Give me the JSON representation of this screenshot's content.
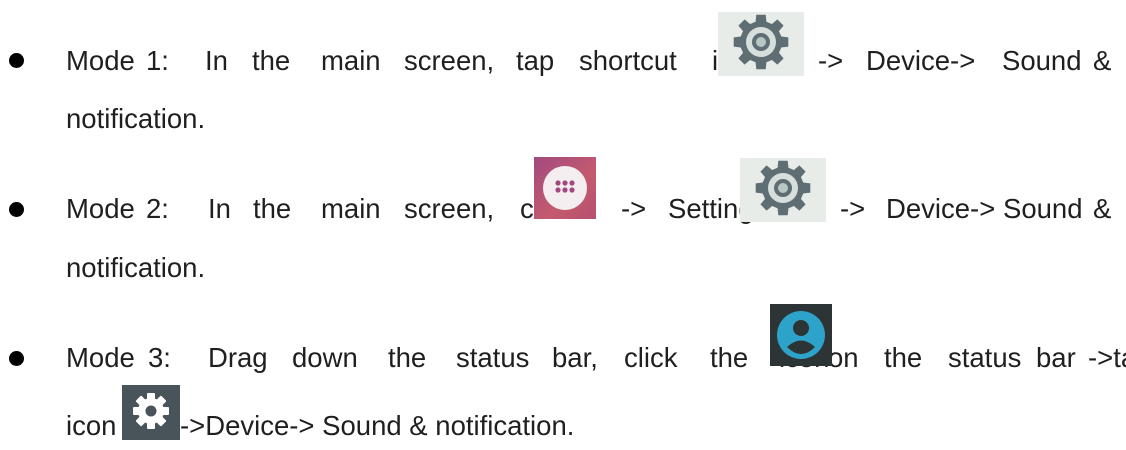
{
  "items": [
    {
      "line1": [
        "Mode",
        "1:",
        "In",
        "the",
        "main",
        "screen,",
        "tap",
        "shortcut",
        "icon",
        "->",
        "Device->",
        "Sound",
        "&"
      ],
      "line2": "notification.",
      "icons": [
        "settings-gear-icon"
      ]
    },
    {
      "line1": [
        "Mode",
        "2:",
        "In",
        "the",
        "main",
        "screen,",
        "click",
        "->",
        "Settings",
        "->",
        "Device->",
        "Sound",
        "&"
      ],
      "line2": "notification.",
      "icons": [
        "app-drawer-icon",
        "settings-gear-icon"
      ]
    },
    {
      "line1": [
        "Mode",
        "3:",
        "Drag",
        "down",
        "the",
        "status",
        "bar,",
        "click",
        "the",
        "icon",
        "on",
        "the",
        "status",
        "bar",
        "->tap"
      ],
      "line2_pre": "icon",
      "line2_post": "->Device-> Sound & notification.",
      "icons": [
        "user-account-icon",
        "settings-gear-icon"
      ]
    }
  ],
  "colors": {
    "text": "#1f1f1f",
    "bullet": "#000000",
    "gear": "#5f6e73",
    "apps": "#b4506f",
    "avatar": "#2ea3c9"
  }
}
